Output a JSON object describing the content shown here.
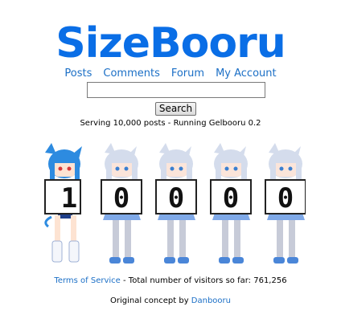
{
  "site": {
    "title": "SizeBooru"
  },
  "nav": {
    "items": [
      {
        "label": "Posts"
      },
      {
        "label": "Comments"
      },
      {
        "label": "Forum"
      },
      {
        "label": "My Account"
      }
    ]
  },
  "search": {
    "value": "",
    "button_label": "Search"
  },
  "status": {
    "serving": "Serving 10,000 posts - Running Gelbooru 0.2"
  },
  "counter": {
    "digits": [
      "1",
      "0",
      "0",
      "0",
      "0"
    ]
  },
  "footer": {
    "tos_link": "Terms of Service",
    "visitors_text": " - Total number of visitors so far: 761,256",
    "concept_text": "Original concept by ",
    "concept_link": "Danbooru"
  },
  "colors": {
    "brand": "#0a6ee6",
    "link": "#1b6fc6",
    "char1_hair": "#2d8be0",
    "char_hair": "#d4dcec"
  }
}
